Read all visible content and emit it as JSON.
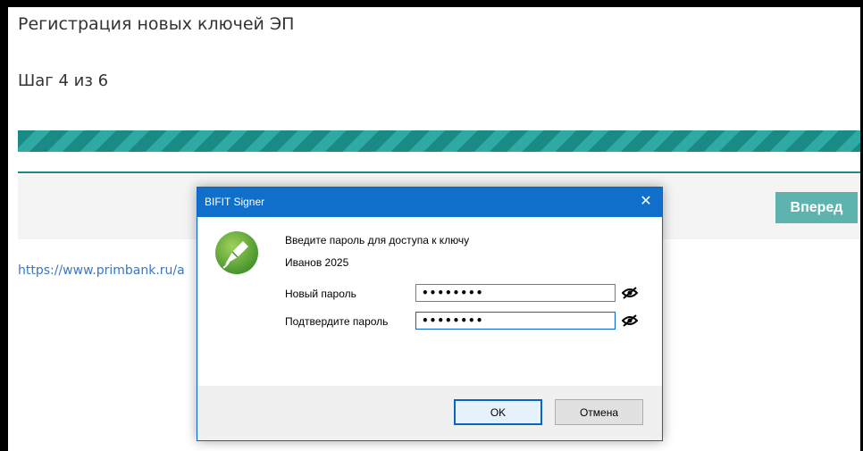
{
  "page": {
    "title": "Регистрация новых ключей ЭП",
    "step": "Шаг 4 из 6",
    "progress": 1.0,
    "next_label": "Вперед",
    "link_text": "https://www.primbank.ru/a"
  },
  "dialog": {
    "title": "BIFIT Signer",
    "close_glyph": "✕",
    "logo_icon": "bifit-pen-logo-icon",
    "prompt": "Введите пароль для доступа к ключу",
    "key_name": "Иванов 2025",
    "fields": [
      {
        "label": "Новый пароль",
        "value": "••••••••",
        "icon": "eye-slash-icon"
      },
      {
        "label": "Подтвердите пароль",
        "value": "••••••••",
        "icon": "eye-slash-icon"
      }
    ],
    "ok_label": "OK",
    "cancel_label": "Отмена"
  },
  "colors": {
    "accent": "#1a8a85",
    "next_button": "#5fb3ae",
    "link": "#3a78c2",
    "titlebar": "#0f6fcb"
  }
}
